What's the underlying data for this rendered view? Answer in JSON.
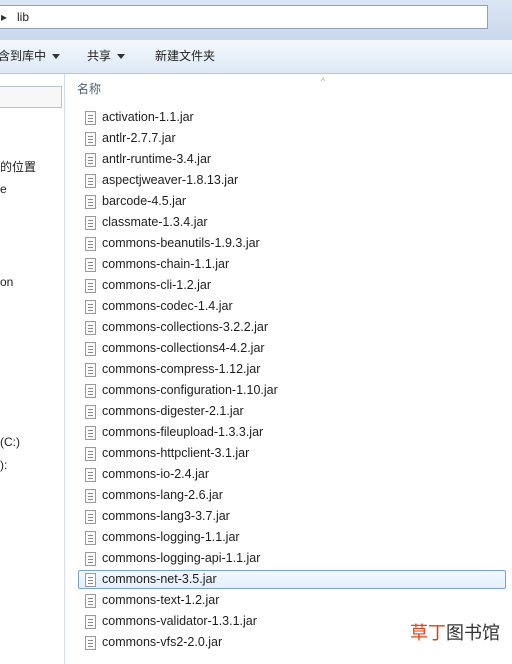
{
  "address_bar": {
    "nav_arrow": "▸",
    "path": "lib"
  },
  "toolbar": {
    "include_in_library": "含到库中",
    "share": "共享",
    "new_folder": "新建文件夹"
  },
  "nav_pane": {
    "items": [
      {
        "label": "的位置"
      },
      {
        "label": "e"
      },
      {
        "label": "on"
      },
      {
        "label": "(C:)"
      },
      {
        "label": "):"
      }
    ]
  },
  "content": {
    "column_header": "名称",
    "sort_indicator": "^",
    "selected_file": "commons-net-3.5.jar",
    "files": [
      "activation-1.1.jar",
      "antlr-2.7.7.jar",
      "antlr-runtime-3.4.jar",
      "aspectjweaver-1.8.13.jar",
      "barcode-4.5.jar",
      "classmate-1.3.4.jar",
      "commons-beanutils-1.9.3.jar",
      "commons-chain-1.1.jar",
      "commons-cli-1.2.jar",
      "commons-codec-1.4.jar",
      "commons-collections-3.2.2.jar",
      "commons-collections4-4.2.jar",
      "commons-compress-1.12.jar",
      "commons-configuration-1.10.jar",
      "commons-digester-2.1.jar",
      "commons-fileupload-1.3.3.jar",
      "commons-httpclient-3.1.jar",
      "commons-io-2.4.jar",
      "commons-lang-2.6.jar",
      "commons-lang3-3.7.jar",
      "commons-logging-1.1.jar",
      "commons-logging-api-1.1.jar",
      "commons-net-3.5.jar",
      "commons-text-1.2.jar",
      "commons-validator-1.3.1.jar",
      "commons-vfs2-2.0.jar"
    ]
  },
  "watermark": {
    "part1": "草丁",
    "part2": "图书馆"
  },
  "colors": {
    "toolbar_bg": "#dde8f5",
    "selection_border": "#7da2ce",
    "watermark_red": "#d9451c"
  }
}
